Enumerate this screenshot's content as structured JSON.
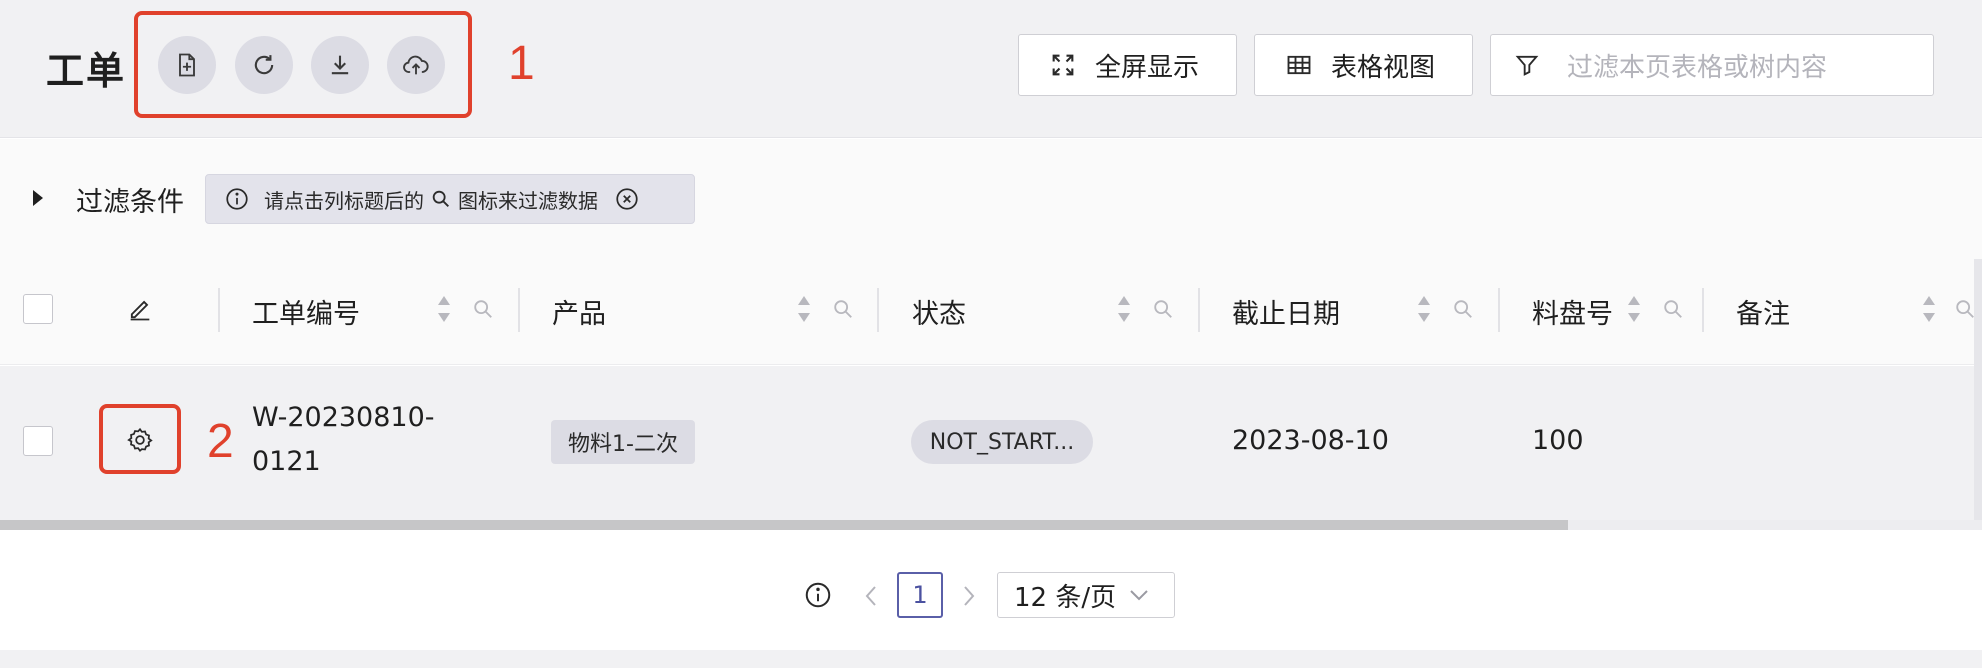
{
  "header": {
    "title": "工单",
    "toolbar_icons": [
      "add-file-icon",
      "refresh-icon",
      "download-icon",
      "upload-cloud-icon"
    ],
    "annotation_1": "1",
    "fullscreen_label": "全屏显示",
    "table_view_label": "表格视图",
    "filter_placeholder": "过滤本页表格或树内容"
  },
  "filter_bar": {
    "label": "过滤条件",
    "hint_before": "请点击列标题后的",
    "hint_after": "图标来过滤数据"
  },
  "table": {
    "columns": [
      "工单编号",
      "产品",
      "状态",
      "截止日期",
      "料盘号",
      "备注"
    ],
    "rows": [
      {
        "order_no_line1": "W-20230810-",
        "order_no_line2": "0121",
        "product": "物料1-二次",
        "status": "NOT_START...",
        "deadline": "2023-08-10",
        "reel_no": "100",
        "remark": ""
      }
    ],
    "annotation_2": "2"
  },
  "pagination": {
    "current_page": "1",
    "page_size": "12 条/页"
  },
  "colors": {
    "accent": "#5a5fa8",
    "annotation": "#e0412c",
    "header_bg": "#f1f1f3"
  }
}
